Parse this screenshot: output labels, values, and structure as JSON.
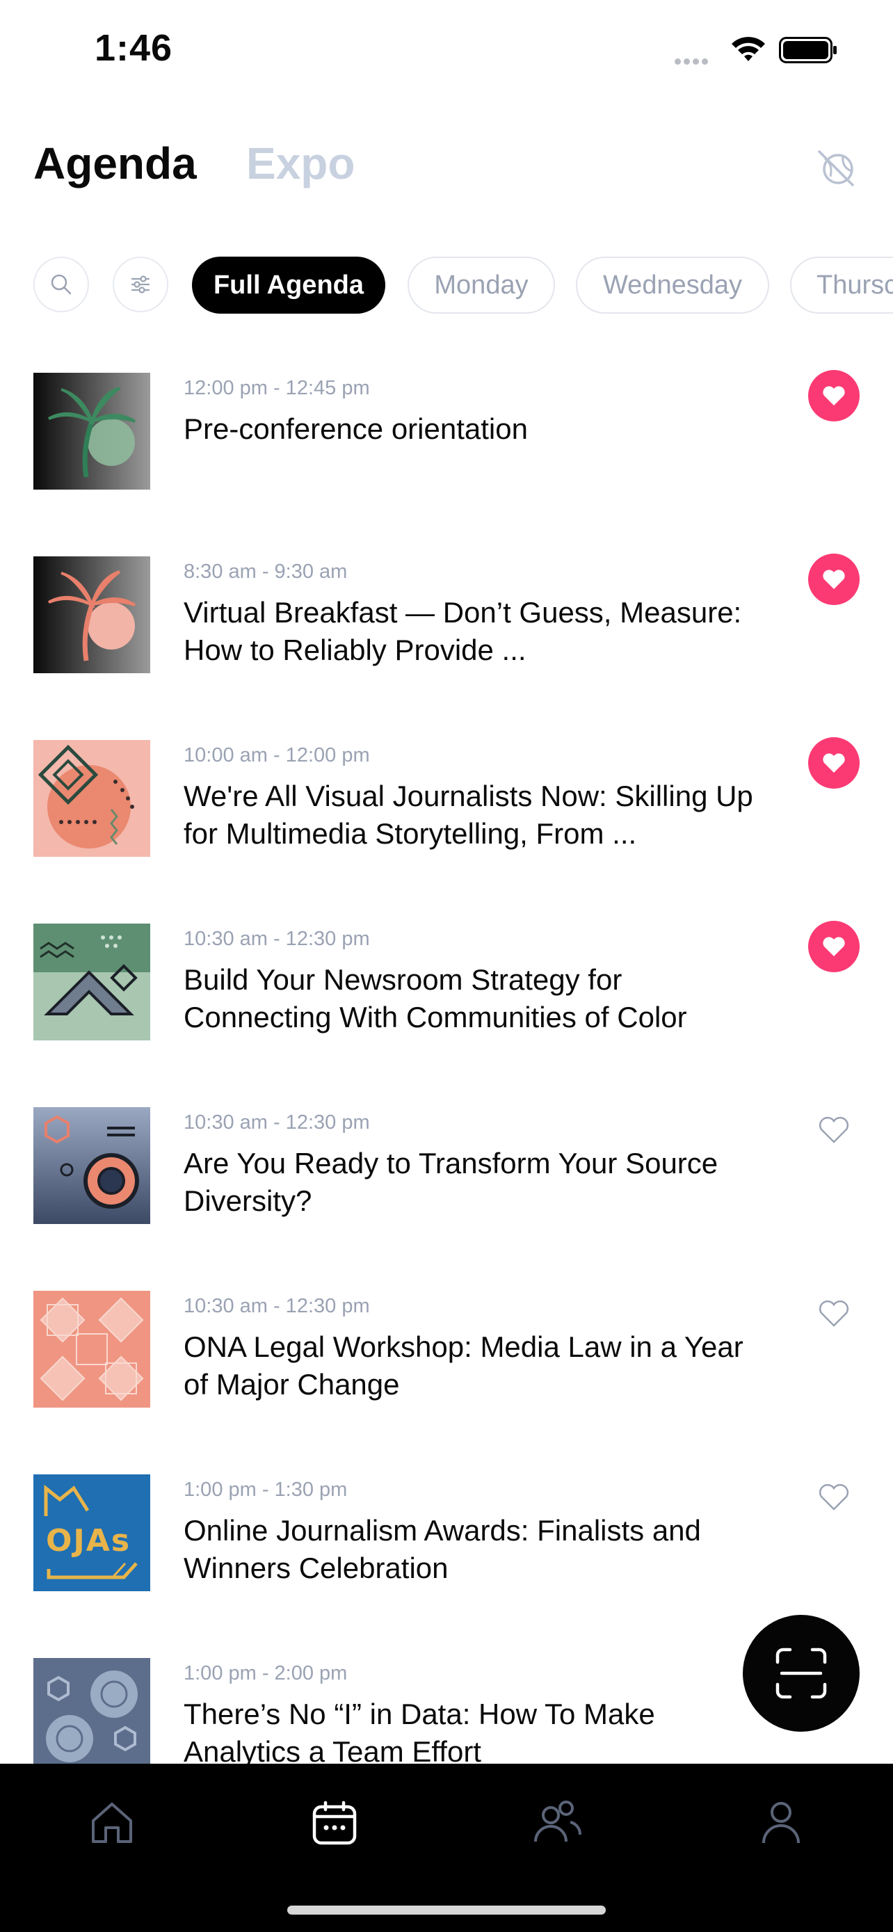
{
  "status_bar": {
    "time": "1:46"
  },
  "header": {
    "tabs": [
      {
        "label": "Agenda",
        "active": true
      },
      {
        "label": "Expo",
        "active": false
      }
    ],
    "action_icon": "globe-crossed-icon"
  },
  "filters": {
    "search_icon": "search-icon",
    "filter_icon": "sliders-icon",
    "chips": [
      {
        "label": "Full Agenda",
        "active": true
      },
      {
        "label": "Monday",
        "active": false
      },
      {
        "label": "Wednesday",
        "active": false
      },
      {
        "label": "Thursc",
        "active": false
      }
    ]
  },
  "sessions": [
    {
      "time": "12:00 pm - 12:45 pm",
      "title": "Pre-conference orientation",
      "favorited": true,
      "thumb": "palm-green"
    },
    {
      "time": "8:30 am - 9:30 am",
      "title": "Virtual Breakfast — Don’t Guess, Measure: How to Reliably Provide ...",
      "favorited": true,
      "thumb": "palm-salmon"
    },
    {
      "time": "10:00 am - 12:00 pm",
      "title": "We're All Visual Journalists Now: Skilling Up for Multimedia Storytelling, From ...",
      "favorited": true,
      "thumb": "diamonds-salmon"
    },
    {
      "time": "10:30 am - 12:30 pm",
      "title": "Build Your Newsroom Strategy for Connecting With Communities of Color",
      "favorited": true,
      "thumb": "chevron-green"
    },
    {
      "time": "10:30 am - 12:30 pm",
      "title": "Are You Ready to Transform Your Source Diversity?",
      "favorited": false,
      "thumb": "target-blue"
    },
    {
      "time": "10:30 am - 12:30 pm",
      "title": "ONA Legal Workshop: Media Law in a Year of Major Change",
      "favorited": false,
      "thumb": "tiles-salmon"
    },
    {
      "time": "1:00 pm - 1:30 pm",
      "title": "Online Journalism Awards: Finalists and Winners Celebration",
      "favorited": false,
      "thumb": "ojas-blue",
      "thumb_text": "OJAs"
    },
    {
      "time": "1:00 pm - 2:00 pm",
      "title": "There’s No “I” in Data: How To Make Analytics a Team Effort",
      "favorited": false,
      "thumb": "circles-slate"
    }
  ],
  "scan_button": {
    "icon": "scan-icon"
  },
  "bottom_nav": [
    {
      "icon": "home-icon",
      "active": false
    },
    {
      "icon": "calendar-icon",
      "active": true
    },
    {
      "icon": "people-icon",
      "active": false
    },
    {
      "icon": "profile-icon",
      "active": false
    }
  ],
  "colors": {
    "accent_heart": "#fb3a73",
    "inactive_text": "#9aa2b3",
    "nav_inactive": "#5b6478",
    "nav_active": "#ffffff"
  }
}
